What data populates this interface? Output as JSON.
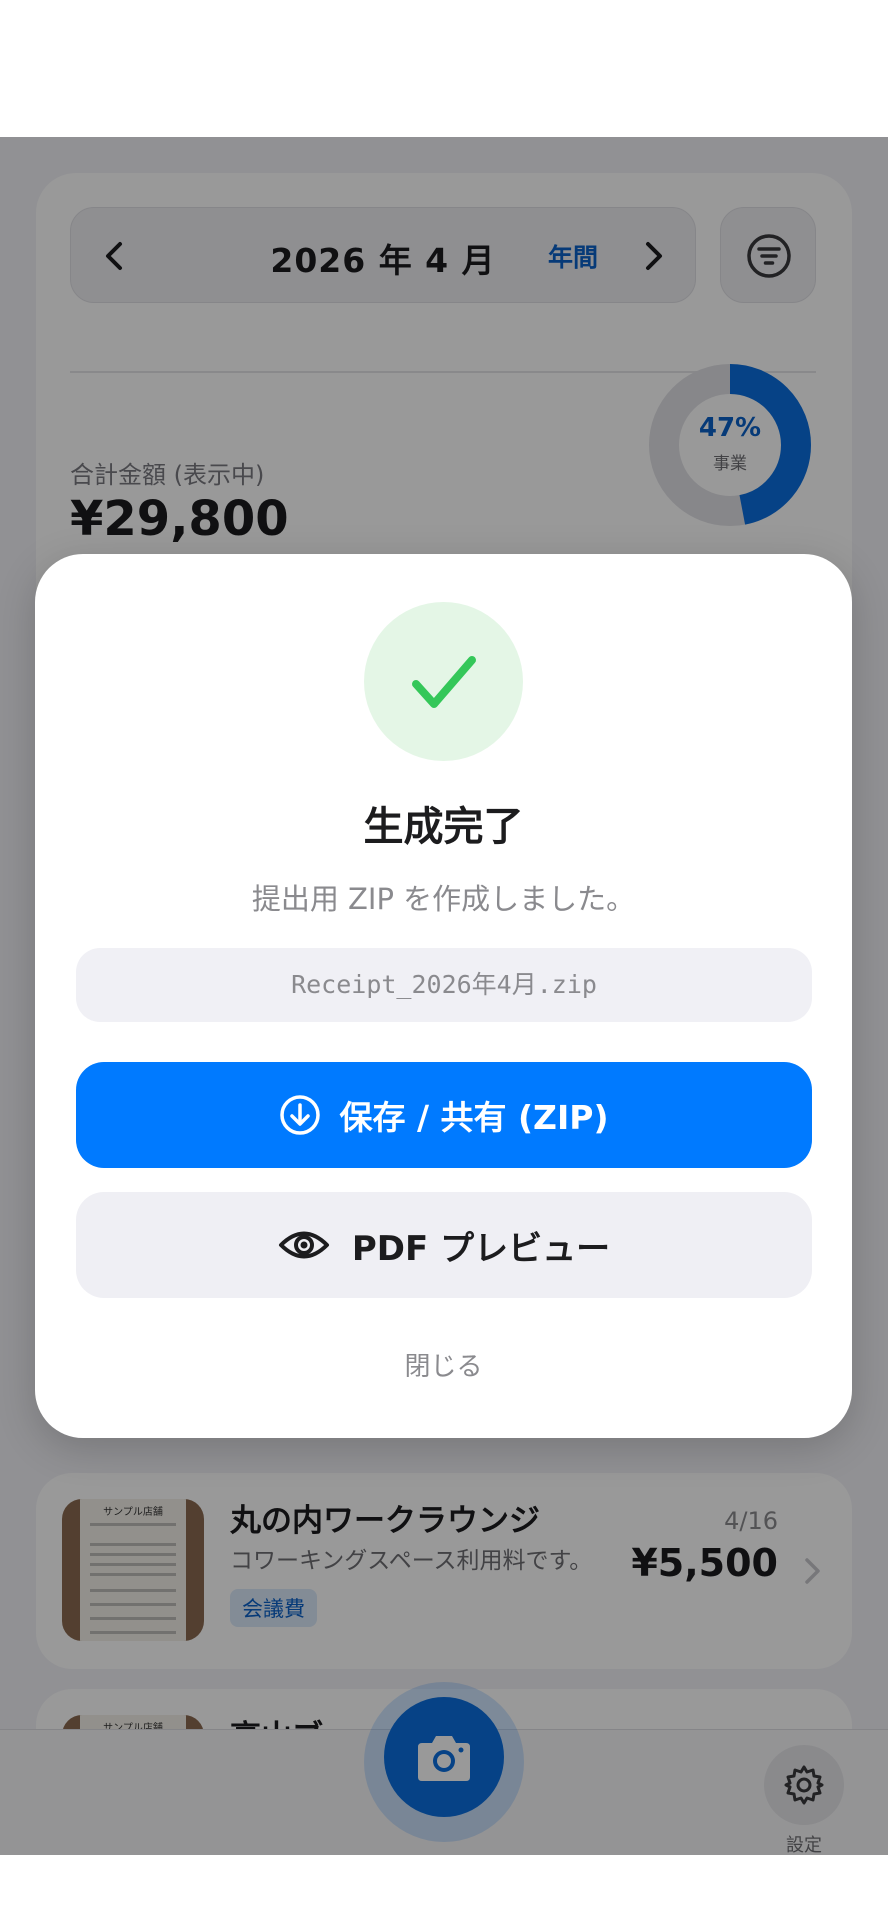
{
  "summary": {
    "month_label": "2026 年 4 月",
    "yearly_label": "年間",
    "total_label": "合計金額 (表示中)",
    "total_amount": "¥29,800",
    "business_ratio": 0.47,
    "business_pct_label": "47%",
    "business_label": "事業"
  },
  "receipts": [
    {
      "thumb_title": "サンプル店舗",
      "name": "丸の内ワークラウンジ",
      "description": "コワーキングスペース利用料です。",
      "category": "会議費",
      "date": "4/16",
      "amount": "¥5,500"
    },
    {
      "thumb_title": "サンプル店舗",
      "name": "高山ブ..."
    }
  ],
  "tab_bar": {
    "settings_label": "設定"
  },
  "modal": {
    "title": "生成完了",
    "message": "提出用 ZIP を作成しました。",
    "filename": "Receipt_2026年4月.zip",
    "save_button_label": "保存 / 共有 (ZIP)",
    "preview_button_label": "PDF プレビュー",
    "close_label": "閉じる"
  },
  "icons": {
    "success": "checkmark-icon",
    "save": "download-circle-icon",
    "preview": "eye-icon",
    "prev_month": "chevron-left-icon",
    "next_month": "chevron-right-icon",
    "filter": "filter-icon",
    "camera": "camera-icon",
    "settings": "gear-icon"
  },
  "colors": {
    "accent": "#007aff",
    "success": "#34c759",
    "success_bg": "#e4f6e6"
  }
}
